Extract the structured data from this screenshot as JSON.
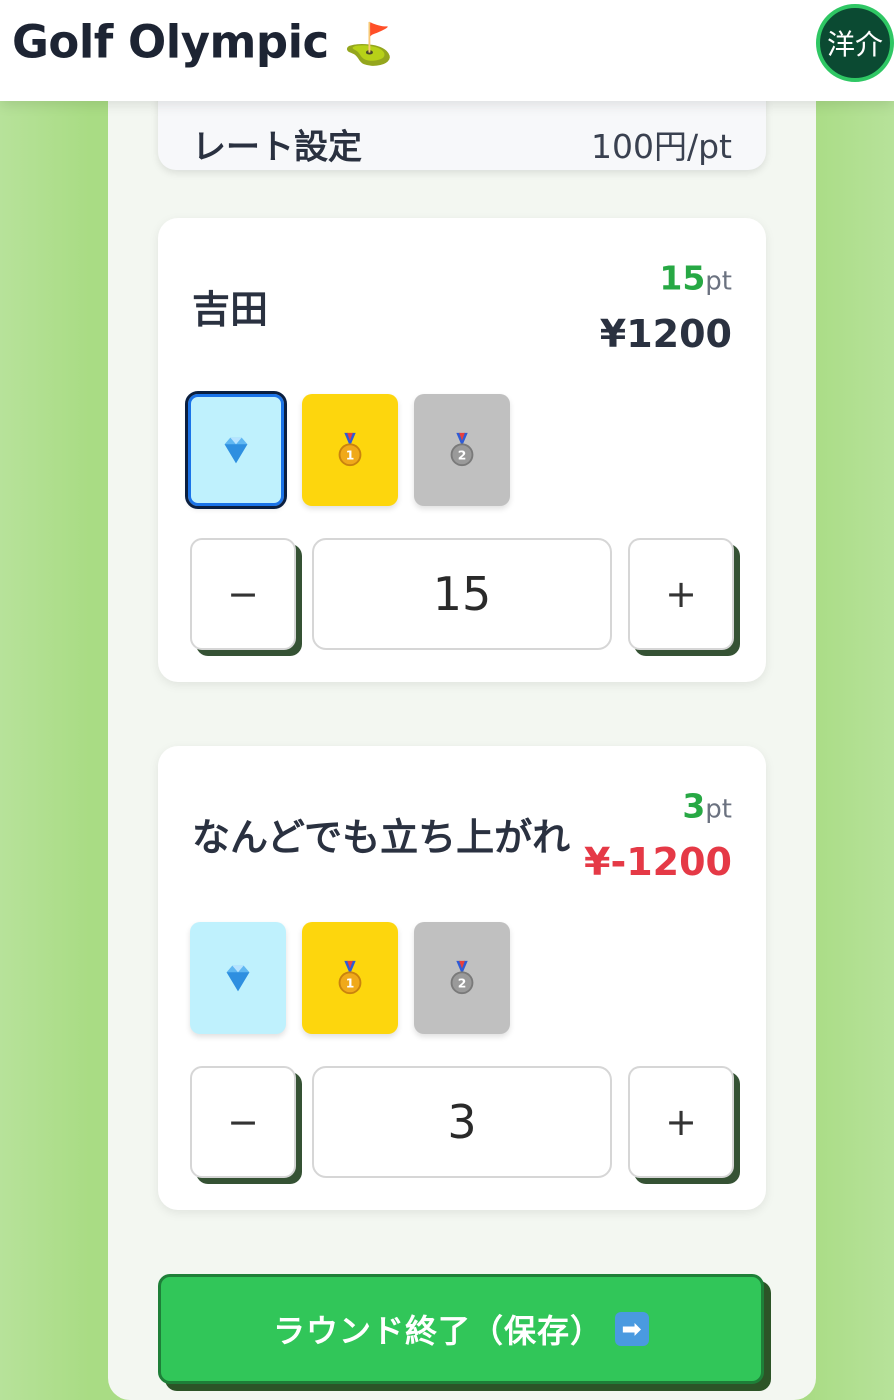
{
  "header": {
    "title": "Golf Olympic",
    "title_emoji": "⛳",
    "avatar_text": "洋介"
  },
  "rate": {
    "label": "レート設定",
    "value": "100円/pt"
  },
  "players": [
    {
      "name": "吉田",
      "points": "15",
      "points_unit": "pt",
      "yen": "¥1200",
      "yen_color": "#2a3140",
      "selected_medal": "diamond",
      "stepper_value": "15"
    },
    {
      "name": "なんどでも立ち上がれ",
      "points": "3",
      "points_unit": "pt",
      "yen": "¥-1200",
      "yen_color": "#e53946",
      "selected_medal": "none",
      "stepper_value": "3"
    }
  ],
  "medals": [
    {
      "name": "diamond",
      "icon": "gem-icon",
      "color": "#bff1fd"
    },
    {
      "name": "gold",
      "icon": "gold-medal-icon",
      "label": "1",
      "color": "#fdd60d"
    },
    {
      "name": "silver",
      "icon": "silver-medal-icon",
      "label": "2",
      "color": "#c0c0c0"
    }
  ],
  "stepper": {
    "minus_label": "−",
    "plus_label": "+"
  },
  "finish_button": {
    "label": "ラウンド終了（保存）",
    "icon": "right-arrow-icon",
    "icon_glyph": "➡"
  },
  "colors": {
    "accent_green": "#31c659",
    "points_green": "#27a844",
    "negative_red": "#e53946",
    "selected_border": "#1a73e8"
  }
}
